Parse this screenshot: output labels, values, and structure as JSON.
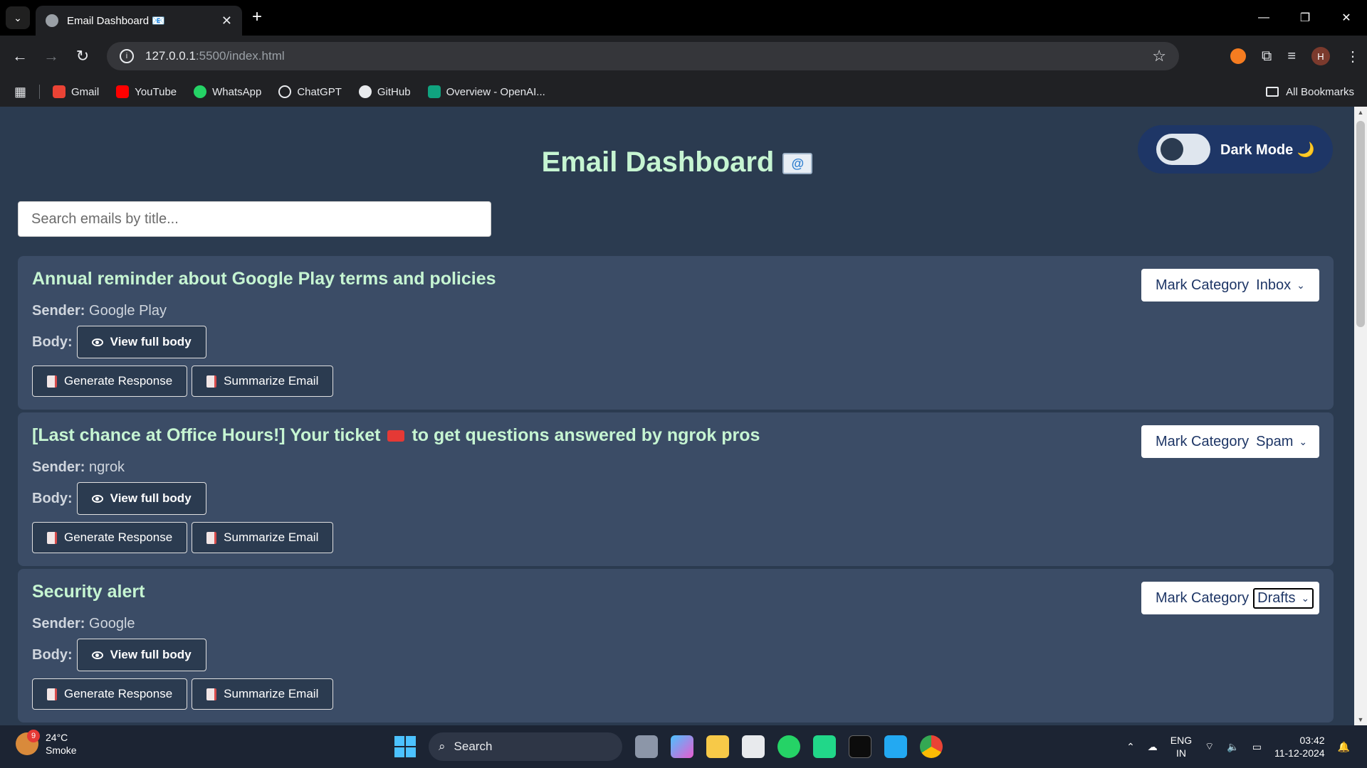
{
  "browser": {
    "tab_title": "Email Dashboard 📧",
    "url_host": "127.0.0.1",
    "url_path": ":5500/index.html",
    "bookmarks": [
      {
        "label": "Gmail",
        "color": "#ea4335"
      },
      {
        "label": "YouTube",
        "color": "#ff0000"
      },
      {
        "label": "WhatsApp",
        "color": "#25d366"
      },
      {
        "label": "ChatGPT",
        "color": "#e8eaed"
      },
      {
        "label": "GitHub",
        "color": "#e8eaed"
      },
      {
        "label": "Overview - OpenAI...",
        "color": "#10a37f"
      }
    ],
    "all_bookmarks": "All Bookmarks",
    "profile_initial": "H"
  },
  "page": {
    "title": "Email Dashboard",
    "dark_mode_label": "Dark Mode 🌙",
    "search_placeholder": "Search emails by title..."
  },
  "labels": {
    "sender": "Sender:",
    "body": "Body:",
    "view_full_body": "View full body",
    "generate_response": "Generate Response",
    "summarize_email": "Summarize Email",
    "mark_category": "Mark Category"
  },
  "emails": [
    {
      "title": "Annual reminder about Google Play terms and policies",
      "title_suffix": "",
      "sender": "Google Play",
      "category": "Inbox"
    },
    {
      "title": "[Last chance at Office Hours!] Your ticket",
      "title_suffix": "to get questions answered by ngrok pros",
      "sender": "ngrok",
      "category": "Spam"
    },
    {
      "title": "Security alert",
      "title_suffix": "",
      "sender": "Google",
      "category": "Drafts"
    }
  ],
  "taskbar": {
    "weather_temp": "24°C",
    "weather_desc": "Smoke",
    "weather_badge": "9",
    "search_label": "Search",
    "lang_line1": "ENG",
    "lang_line2": "IN",
    "time": "03:42",
    "date": "11-12-2024"
  },
  "colors": {
    "page_bg": "#2b3b50",
    "card_bg": "#3b4c66",
    "title_green": "#c6f5d2",
    "toggle_bg": "#1e3666"
  }
}
